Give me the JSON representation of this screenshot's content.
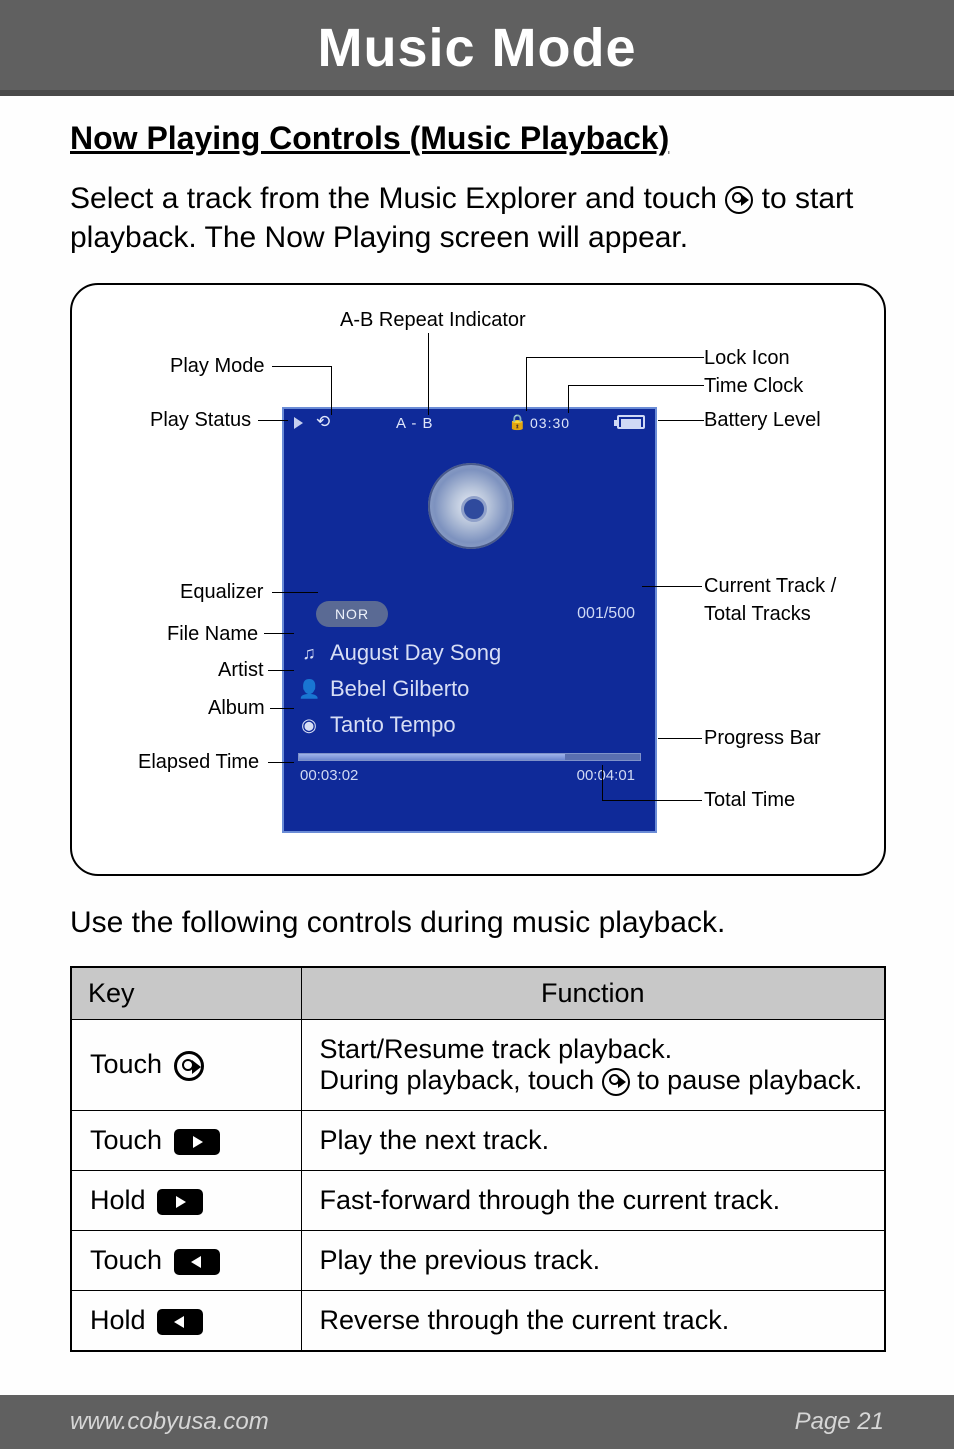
{
  "header": {
    "title": "Music Mode"
  },
  "section": {
    "heading": "Now Playing Controls (Music Playback)",
    "intro_part1": "Select a track from the Music Explorer and touch ",
    "intro_part2": " to start playback. The Now Playing screen will appear.",
    "controls_intro": "Use the following controls during music playback."
  },
  "diagram": {
    "labels": {
      "ab_repeat": "A-B Repeat Indicator",
      "play_mode": "Play Mode",
      "play_status": "Play Status",
      "lock_icon": "Lock Icon",
      "time_clock": "Time Clock",
      "battery_level": "Battery Level",
      "equalizer": "Equalizer",
      "current_tracks_1": "Current Track /",
      "current_tracks_2": "Total Tracks",
      "file_name": "File Name",
      "artist": "Artist",
      "album": "Album",
      "elapsed_time": "Elapsed Time",
      "progress_bar": "Progress Bar",
      "total_time": "Total Time"
    },
    "screen": {
      "ab": "A - B",
      "clock": "03:30",
      "eq": "NOR",
      "track_counter": "001/500",
      "file_name": "August Day Song",
      "artist": "Bebel Gilberto",
      "album": "Tanto Tempo",
      "elapsed": "00:03:02",
      "total": "00:04:01",
      "repeat_glyph": "⟲"
    }
  },
  "table": {
    "headers": {
      "key": "Key",
      "function": "Function"
    },
    "rows": [
      {
        "key_prefix": "Touch ",
        "key_icon": "play-circle",
        "fn_line1": "Start/Resume track playback.",
        "fn_line2a": "During playback, touch ",
        "fn_line2b": " to pause playback."
      },
      {
        "key_prefix": "Touch ",
        "key_icon": "next",
        "fn": "Play the next track."
      },
      {
        "key_prefix": "Hold ",
        "key_icon": "next",
        "fn": "Fast-forward through the current track."
      },
      {
        "key_prefix": "Touch ",
        "key_icon": "prev",
        "fn": "Play the previous track."
      },
      {
        "key_prefix": "Hold ",
        "key_icon": "prev",
        "fn": "Reverse through the current track."
      }
    ]
  },
  "footer": {
    "url": "www.cobyusa.com",
    "page": "Page 21"
  }
}
